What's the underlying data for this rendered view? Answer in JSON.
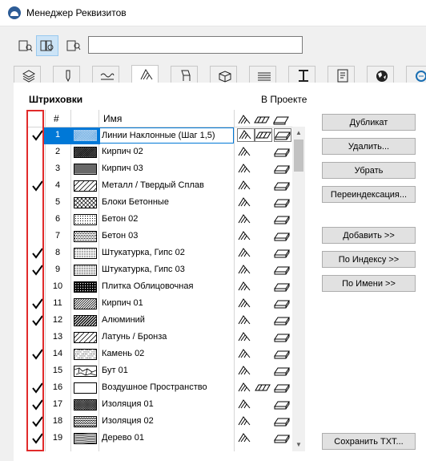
{
  "window": {
    "title": "Менеджер Реквизитов"
  },
  "toolbar": {
    "search_value": ""
  },
  "tabs": [
    {
      "icon": "layers-icon"
    },
    {
      "icon": "pen-icon"
    },
    {
      "icon": "line-type-icon"
    },
    {
      "icon": "fill-icon",
      "active": true
    },
    {
      "icon": "composite-icon"
    },
    {
      "icon": "building-material-icon"
    },
    {
      "icon": "profile-icon"
    },
    {
      "icon": "column-icon"
    },
    {
      "icon": "zone-icon"
    },
    {
      "icon": "globe-icon"
    },
    {
      "icon": "mep-icon"
    }
  ],
  "fills": {
    "title": "Штриховки",
    "in_project_label": "В Проекте",
    "columns": {
      "num": "#",
      "name": "Имя"
    },
    "rows": [
      {
        "num": "1",
        "name": "Линии Наклонные (Шаг 1,5)",
        "checked": true,
        "selected": true,
        "pattern": "diag-blue"
      },
      {
        "num": "2",
        "name": "Кирпич 02",
        "checked": false,
        "pattern": "brick-dense"
      },
      {
        "num": "3",
        "name": "Кирпич 03",
        "checked": false,
        "pattern": "grid-fine"
      },
      {
        "num": "4",
        "name": "Металл / Твердый Сплав",
        "checked": true,
        "pattern": "diag-wide"
      },
      {
        "num": "5",
        "name": "Блоки Бетонные",
        "checked": false,
        "pattern": "cross-wide"
      },
      {
        "num": "6",
        "name": "Бетон 02",
        "checked": false,
        "pattern": "dots"
      },
      {
        "num": "7",
        "name": "Бетон 03",
        "checked": false,
        "pattern": "dots-dense"
      },
      {
        "num": "8",
        "name": "Штукатурка, Гипс 02",
        "checked": true,
        "pattern": "dots-fine"
      },
      {
        "num": "9",
        "name": "Штукатурка, Гипс 03",
        "checked": true,
        "pattern": "dots-fine2"
      },
      {
        "num": "10",
        "name": "Плитка Облицовочная",
        "checked": false,
        "pattern": "tile"
      },
      {
        "num": "11",
        "name": "Кирпич 01",
        "checked": true,
        "pattern": "diag-double"
      },
      {
        "num": "12",
        "name": "Алюминий",
        "checked": true,
        "pattern": "diag-thick"
      },
      {
        "num": "13",
        "name": "Латунь / Бронза",
        "checked": false,
        "pattern": "diag-wide"
      },
      {
        "num": "14",
        "name": "Камень 02",
        "checked": true,
        "pattern": "stone"
      },
      {
        "num": "15",
        "name": "Бут 01",
        "checked": false,
        "pattern": "rubble"
      },
      {
        "num": "16",
        "name": "Воздушное Пространство",
        "checked": true,
        "pattern": "empty"
      },
      {
        "num": "17",
        "name": "Изоляция 01",
        "checked": true,
        "pattern": "cross-fine"
      },
      {
        "num": "18",
        "name": "Изоляция 02",
        "checked": true,
        "pattern": "zigzag"
      },
      {
        "num": "19",
        "name": "Дерево 01",
        "checked": true,
        "pattern": "wood"
      }
    ]
  },
  "buttons": {
    "duplicate": "Дубликат",
    "delete": "Удалить...",
    "remove": "Убрать",
    "reindex": "Переиндексация...",
    "add": "Добавить >>",
    "by_index": "По Индексу >>",
    "by_name": "По Имени >>",
    "save_txt": "Сохранить TXT..."
  }
}
